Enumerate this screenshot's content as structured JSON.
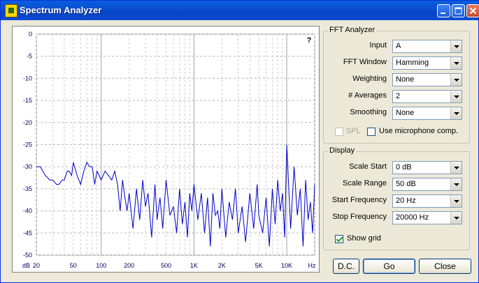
{
  "window": {
    "title": "Spectrum Analyzer"
  },
  "plot": {
    "help_mark": "?",
    "y_ticks": [
      "0",
      "-5",
      "-10",
      "-15",
      "-20",
      "-25",
      "-30",
      "-35",
      "-40",
      "-45",
      "-50"
    ],
    "y_unit": "dB",
    "x_ticks": [
      "20",
      "50",
      "100",
      "200",
      "500",
      "1K",
      "2K",
      "5K",
      "10K",
      "Hz"
    ],
    "line_color": "#0000c8"
  },
  "chart_data": {
    "type": "line",
    "title": "",
    "xlabel": "Hz",
    "ylabel": "dB",
    "x_scale": "log",
    "xlim": [
      20,
      20000
    ],
    "ylim": [
      -50,
      0
    ],
    "grid": true,
    "series": [
      {
        "x": [
          20,
          22,
          25,
          28,
          30,
          33,
          35,
          38,
          40,
          43,
          45,
          48,
          50,
          55,
          60,
          65,
          70,
          75,
          80,
          85,
          90,
          95,
          100,
          110,
          120,
          130,
          140,
          150,
          160,
          170,
          180,
          190,
          200,
          220,
          240,
          260,
          280,
          300,
          320,
          350,
          380,
          400,
          430,
          460,
          500,
          550,
          600,
          650,
          700,
          750,
          800,
          850,
          900,
          950,
          1000,
          1100,
          1200,
          1300,
          1400,
          1500,
          1600,
          1700,
          1800,
          1900,
          2000,
          2200,
          2400,
          2600,
          2800,
          3000,
          3300,
          3600,
          4000,
          4400,
          4800,
          5000,
          5500,
          6000,
          6500,
          7000,
          7500,
          8000,
          8500,
          9000,
          9500,
          10000,
          11000,
          12000,
          13000,
          14000,
          15000,
          16000,
          17000,
          18000,
          19000,
          20000
        ],
        "values": [
          -30,
          -30,
          -32,
          -33,
          -33,
          -34,
          -34,
          -33,
          -33,
          -31,
          -31,
          -32,
          -29,
          -32,
          -34,
          -31,
          -29,
          -30,
          -30,
          -34,
          -31,
          -32,
          -33,
          -31,
          -32,
          -33,
          -31,
          -34,
          -40,
          -33,
          -37,
          -40,
          -36,
          -44,
          -35,
          -42,
          -33,
          -39,
          -36,
          -46,
          -34,
          -42,
          -37,
          -44,
          -33,
          -41,
          -39,
          -45,
          -35,
          -43,
          -38,
          -46,
          -36,
          -40,
          -34,
          -42,
          -36,
          -45,
          -37,
          -48,
          -36,
          -41,
          -40,
          -44,
          -35,
          -46,
          -38,
          -42,
          -35,
          -45,
          -39,
          -47,
          -36,
          -44,
          -34,
          -41,
          -45,
          -37,
          -48,
          -35,
          -43,
          -33,
          -40,
          -36,
          -46,
          -25,
          -44,
          -30,
          -41,
          -35,
          -48,
          -33,
          -42,
          -38,
          -45,
          -34
        ]
      }
    ]
  },
  "fft_analyzer": {
    "group_title": "FFT Analyzer",
    "input": {
      "label": "Input",
      "value": "A"
    },
    "fft_window": {
      "label": "FFT Window",
      "value": "Hamming"
    },
    "weighting": {
      "label": "Weighting",
      "value": "None"
    },
    "averages": {
      "label": "# Averages",
      "value": "2"
    },
    "smoothing": {
      "label": "Smoothing",
      "value": "None"
    },
    "spl": {
      "label": "SPL",
      "checked": false,
      "disabled": true
    },
    "mic_comp": {
      "label": "Use microphone comp.",
      "checked": false
    }
  },
  "display": {
    "group_title": "Display",
    "scale_start": {
      "label": "Scale Start",
      "value": "0 dB"
    },
    "scale_range": {
      "label": "Scale Range",
      "value": "50 dB"
    },
    "start_frequency": {
      "label": "Start Frequency",
      "value": "20 Hz"
    },
    "stop_frequency": {
      "label": "Stop Frequency",
      "value": "20000 Hz"
    },
    "show_grid": {
      "label": "Show grid",
      "checked": true
    }
  },
  "buttons": {
    "dc": "D.C.",
    "go": "Go",
    "close": "Close"
  }
}
